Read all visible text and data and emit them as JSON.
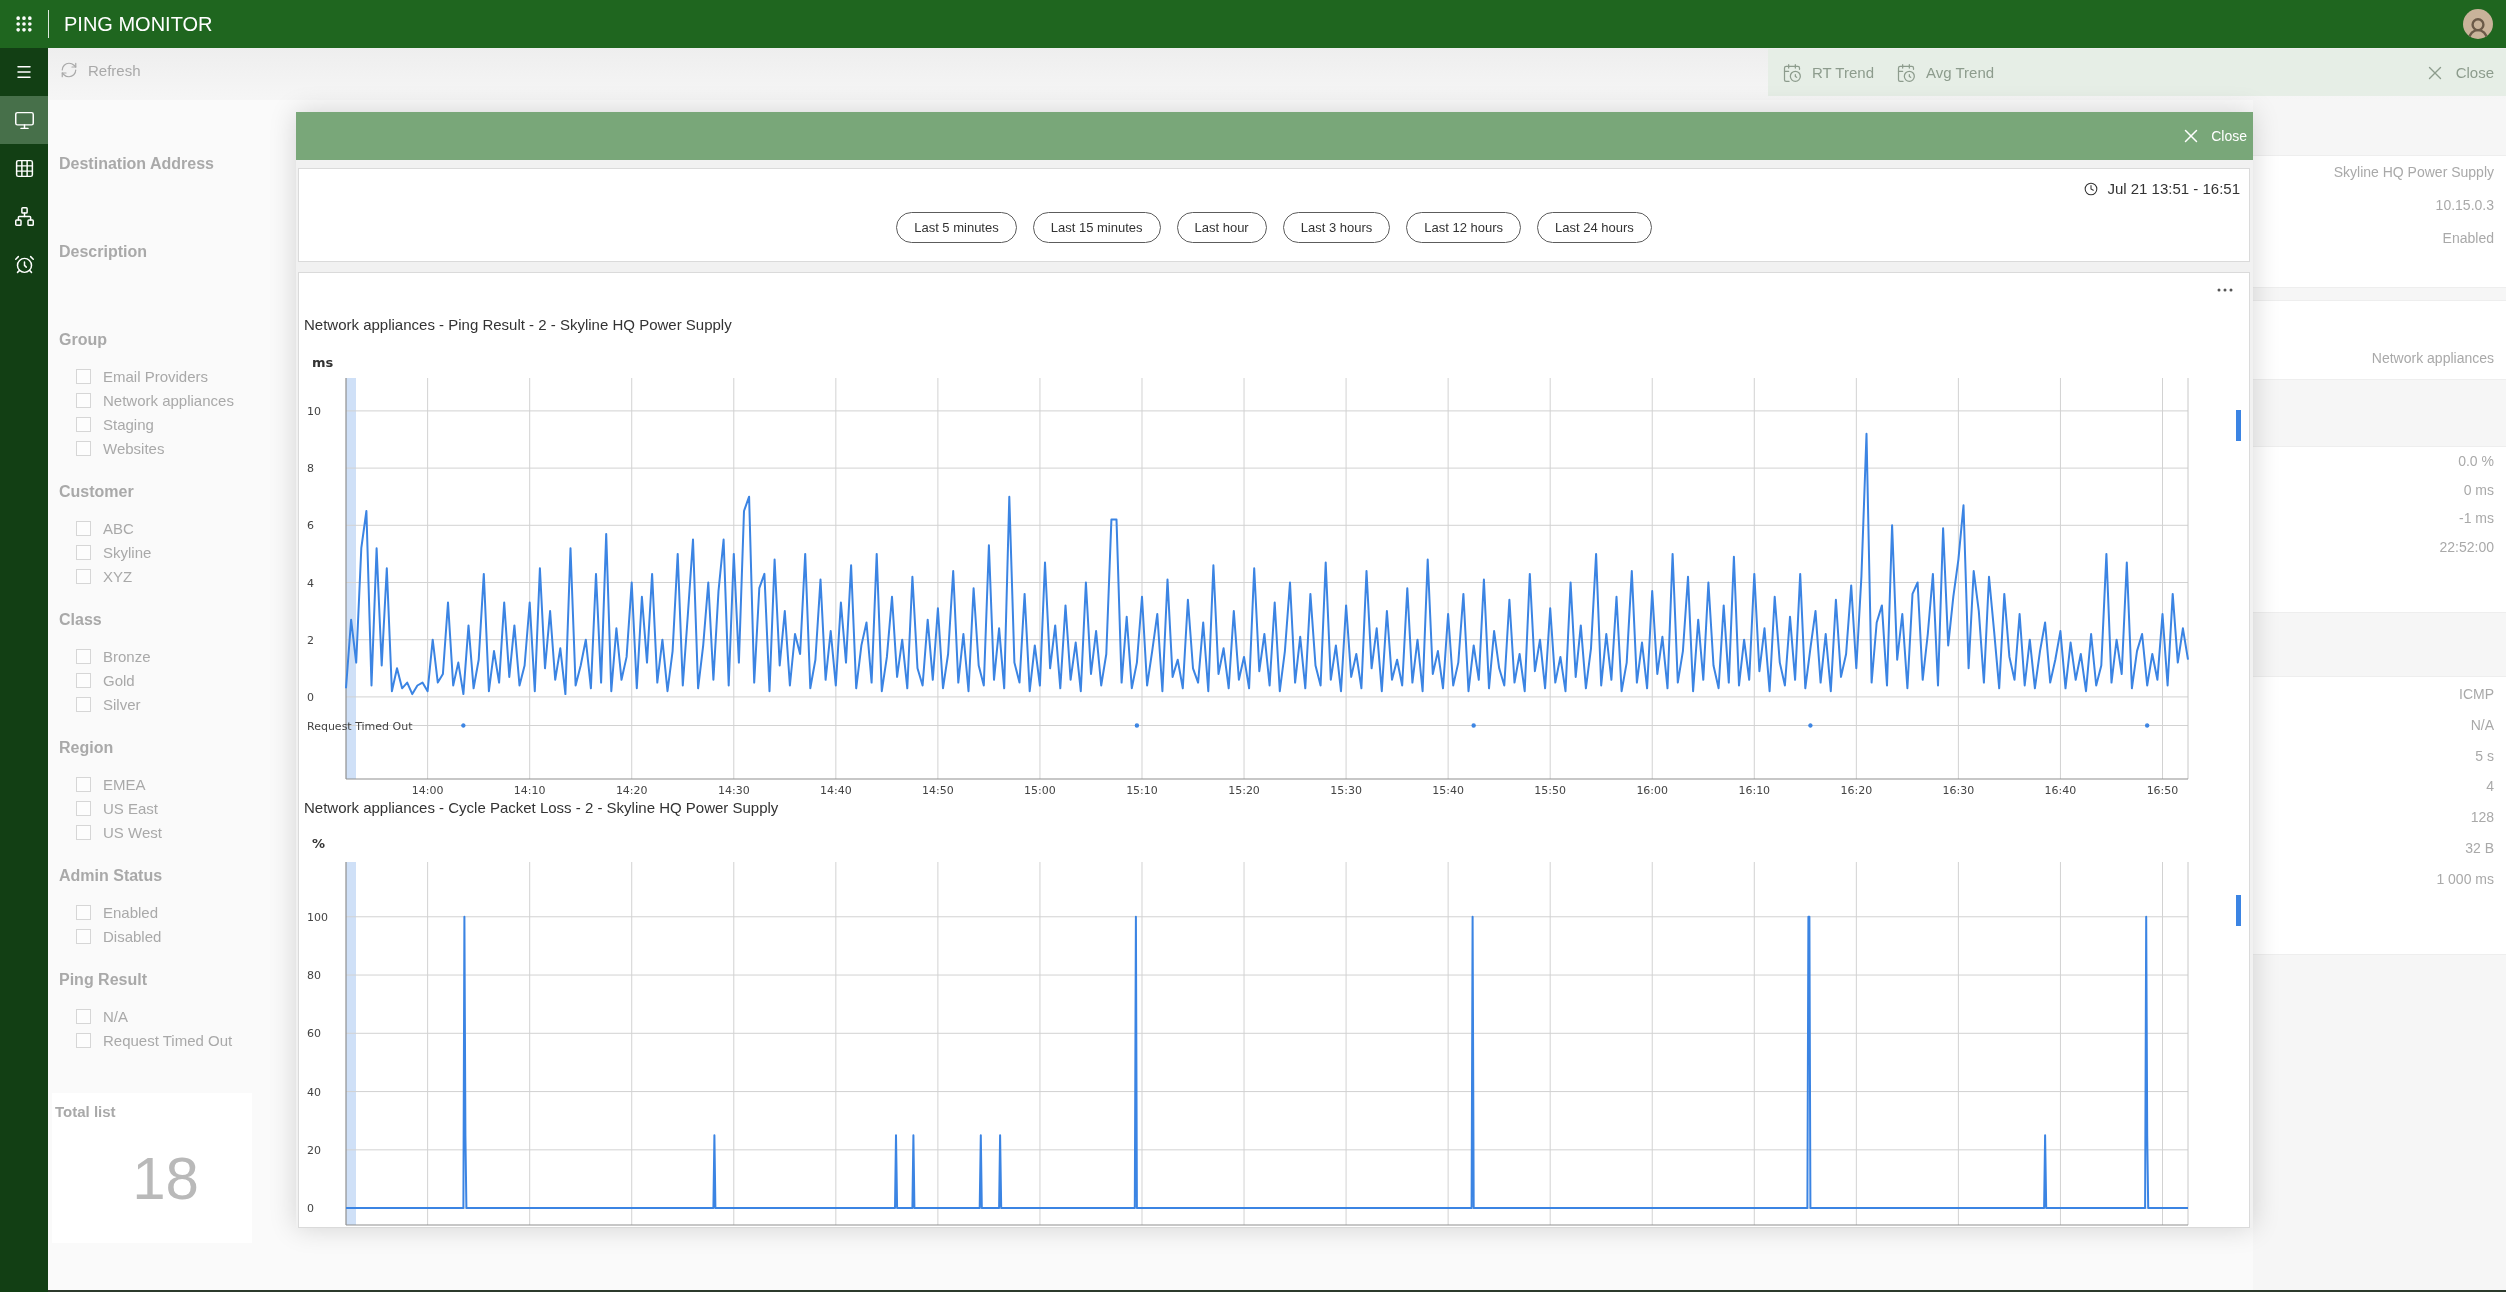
{
  "top_bar": {
    "title": "PING MONITOR"
  },
  "sidebar": {
    "items": [
      {
        "selected": true
      },
      {
        "selected": false
      },
      {
        "selected": false
      },
      {
        "selected": false
      }
    ]
  },
  "toolbar": {
    "refresh": "Refresh"
  },
  "filters": {
    "fields": [
      {
        "label": "Destination Address"
      },
      {
        "label": "Description"
      }
    ],
    "groups": [
      {
        "title": "Group",
        "options": [
          {
            "label": "Email Providers",
            "checked": false
          },
          {
            "label": "Network appliances",
            "checked": false
          },
          {
            "label": "Staging",
            "checked": false
          },
          {
            "label": "Websites",
            "checked": false
          }
        ]
      },
      {
        "title": "Customer",
        "options": [
          {
            "label": "ABC",
            "checked": false
          },
          {
            "label": "Skyline",
            "checked": false
          },
          {
            "label": "XYZ",
            "checked": false
          }
        ]
      },
      {
        "title": "Class",
        "options": [
          {
            "label": "Bronze",
            "checked": false
          },
          {
            "label": "Gold",
            "checked": false
          },
          {
            "label": "Silver",
            "checked": false
          }
        ]
      },
      {
        "title": "Region",
        "options": [
          {
            "label": "EMEA",
            "checked": false
          },
          {
            "label": "US East",
            "checked": false
          },
          {
            "label": "US West",
            "checked": false
          }
        ]
      },
      {
        "title": "Admin Status",
        "options": [
          {
            "label": "Enabled",
            "checked": false
          },
          {
            "label": "Disabled",
            "checked": false
          }
        ]
      },
      {
        "title": "Ping Result",
        "options": [
          {
            "label": "N/A",
            "checked": false
          },
          {
            "label": "Request Timed Out",
            "checked": false
          }
        ]
      }
    ]
  },
  "summary": {
    "cards": [
      {
        "title": "Total list",
        "value": "18"
      }
    ]
  },
  "detail_toolbar": {
    "buttons": [
      "RT Trend",
      "Avg Trend"
    ],
    "close": "Close"
  },
  "details": {
    "cards": [
      [
        "Skyline HQ Power Supply",
        "10.15.0.3",
        "Enabled"
      ],
      [
        "Network appliances"
      ],
      [
        "0.0 %",
        "0 ms",
        "-1 ms",
        "22:52:00"
      ],
      [
        "ICMP",
        "N/A",
        "5 s",
        "4",
        "128",
        "32 B",
        "1 000 ms"
      ]
    ]
  },
  "dialog": {
    "close": "Close",
    "time_range": "Jul 21 13:51 - 16:51",
    "presets": [
      "Last 5 minutes",
      "Last 15 minutes",
      "Last hour",
      "Last 3 hours",
      "Last 12 hours",
      "Last 24 hours"
    ],
    "charts": [
      {
        "chart_data": {
          "type": "line",
          "title": "Network appliances - Ping Result - 2 - Skyline HQ Power Supply",
          "ylabel": "ms",
          "x": [
            832,
            832.5,
            833,
            833.5,
            834,
            834.5,
            835,
            835.5,
            836,
            836.5,
            837,
            837.5,
            838,
            838.5,
            839,
            839.5,
            840,
            840.5,
            841,
            841.5,
            842,
            842.5,
            843,
            843.5,
            844,
            844.5,
            845,
            845.5,
            846,
            846.5,
            847,
            847.5,
            848,
            848.5,
            849,
            849.5,
            850,
            850.5,
            851,
            851.5,
            852,
            852.5,
            853,
            853.5,
            854,
            854.5,
            855,
            855.5,
            856,
            856.5,
            857,
            857.5,
            858,
            858.5,
            859,
            859.5,
            860,
            860.5,
            861,
            861.5,
            862,
            862.5,
            863,
            863.5,
            864,
            864.5,
            865,
            865.5,
            866,
            866.5,
            867,
            867.5,
            868,
            868.5,
            869,
            869.5,
            870,
            870.5,
            871,
            871.5,
            872,
            872.5,
            873,
            873.5,
            874,
            874.5,
            875,
            875.5,
            876,
            876.5,
            877,
            877.5,
            878,
            878.5,
            879,
            879.5,
            880,
            880.5,
            881,
            881.5,
            882,
            882.5,
            883,
            883.5,
            884,
            884.5,
            885,
            885.5,
            886,
            886.5,
            887,
            887.5,
            888,
            888.5,
            889,
            889.5,
            890,
            890.5,
            891,
            891.5,
            892,
            892.5,
            893,
            893.5,
            894,
            894.5,
            895,
            895.5,
            896,
            896.5,
            897,
            897.5,
            898,
            898.5,
            899,
            899.5,
            900,
            900.5,
            901,
            901.5,
            902,
            902.5,
            903,
            903.5,
            904,
            904.5,
            905,
            905.5,
            906,
            906.5,
            907,
            907.5,
            908,
            908.5,
            909,
            909.5,
            910,
            910.5,
            911,
            911.5,
            912,
            912.5,
            913,
            913.5,
            914,
            914.5,
            915,
            915.5,
            916,
            916.5,
            917,
            917.5,
            918,
            918.5,
            919,
            919.5,
            920,
            920.5,
            921,
            921.5,
            922,
            922.5,
            923,
            923.5,
            924,
            924.5,
            925,
            925.5,
            926,
            926.5,
            927,
            927.5,
            928,
            928.5,
            929,
            929.5,
            930,
            930.5,
            931,
            931.5,
            932,
            932.5,
            933,
            933.5,
            934,
            934.5,
            935,
            935.5,
            936,
            936.5,
            937,
            937.5,
            938,
            938.5,
            939,
            939.5,
            940,
            940.5,
            941,
            941.5,
            942,
            942.5,
            943,
            943.5,
            944,
            944.5,
            945,
            945.5,
            946,
            946.5,
            947,
            947.5,
            948,
            948.5,
            949,
            949.5,
            950,
            950.5,
            951,
            951.5,
            952,
            952.5,
            953,
            953.5,
            954,
            954.5,
            955,
            955.5,
            956,
            956.5,
            957,
            957.5,
            958,
            958.5,
            959,
            959.5,
            960,
            960.5,
            961,
            961.5,
            962,
            962.5,
            963,
            963.5,
            964,
            964.5,
            965,
            965.5,
            966,
            966.5,
            967,
            967.5,
            968,
            968.5,
            969,
            969.5,
            970,
            970.5,
            971,
            971.5,
            972,
            972.5,
            973,
            973.5,
            974,
            974.5,
            975,
            975.5,
            976,
            976.5,
            977,
            977.5,
            978,
            978.5,
            979,
            979.5,
            980,
            980.5,
            981,
            981.5,
            982,
            982.5,
            983,
            983.5,
            984,
            984.5,
            985,
            985.5,
            986,
            986.5,
            987,
            987.5,
            988,
            988.5,
            989,
            989.5,
            990,
            990.5,
            991,
            991.5,
            992,
            992.5,
            993,
            993.5,
            994,
            994.5,
            995,
            995.5,
            996,
            996.5,
            997,
            997.5,
            998,
            998.5,
            999,
            999.5,
            1000,
            1000.5,
            1001,
            1001.5,
            1002,
            1002.5,
            1003,
            1003.5,
            1004,
            1004.5,
            1005,
            1005.5,
            1006,
            1006.5,
            1007,
            1007.5,
            1008,
            1008.5,
            1009,
            1009.5,
            1010,
            1010.5,
            1011,
            1011.5,
            1012,
            1012.5
          ],
          "series": [
            {
              "color": "#3b84e3",
              "values": [
                0.3,
                2.7,
                1.2,
                5.2,
                6.5,
                0.4,
                5.2,
                1.1,
                4.5,
                0.2,
                1.0,
                0.3,
                0.5,
                0.1,
                0.4,
                0.5,
                0.2,
                2.0,
                0.5,
                0.8,
                3.3,
                0.4,
                1.2,
                0.1,
                2.5,
                0.3,
                1.3,
                4.3,
                0.2,
                1.6,
                0.5,
                3.3,
                0.7,
                2.5,
                0.4,
                1.1,
                3.3,
                0.2,
                4.5,
                1.0,
                3.0,
                0.6,
                1.7,
                0.1,
                5.2,
                0.4,
                1.1,
                2.0,
                0.3,
                4.3,
                0.5,
                5.7,
                0.2,
                2.4,
                0.6,
                1.4,
                4.0,
                0.3,
                3.5,
                1.2,
                4.3,
                0.5,
                2.0,
                0.2,
                1.6,
                5.0,
                0.4,
                2.9,
                5.5,
                0.3,
                1.8,
                4.0,
                0.6,
                3.7,
                5.5,
                0.4,
                5.0,
                1.2,
                6.5,
                7.0,
                0.5,
                3.8,
                4.3,
                0.2,
                4.8,
                1.1,
                3.0,
                0.4,
                2.2,
                1.5,
                5.0,
                0.3,
                1.3,
                4.1,
                0.6,
                2.3,
                0.4,
                3.3,
                1.2,
                4.6,
                0.3,
                1.8,
                2.6,
                0.5,
                5.0,
                0.2,
                1.4,
                3.5,
                0.7,
                2.0,
                0.3,
                4.2,
                1.0,
                0.4,
                2.7,
                0.6,
                3.1,
                0.3,
                1.5,
                4.4,
                0.5,
                2.2,
                0.2,
                3.8,
                1.1,
                0.4,
                5.3,
                0.6,
                2.4,
                0.3,
                7.0,
                1.2,
                0.5,
                3.6,
                0.2,
                1.8,
                0.4,
                4.7,
                1.0,
                2.5,
                0.3,
                3.2,
                0.6,
                1.9,
                0.2,
                4.0,
                0.8,
                2.3,
                0.4,
                1.5,
                6.2,
                6.2,
                0.5,
                2.8,
                0.3,
                1.2,
                3.5,
                0.4,
                1.6,
                2.9,
                0.2,
                4.1,
                0.7,
                1.3,
                0.3,
                3.4,
                1.0,
                0.5,
                2.6,
                0.2,
                4.6,
                0.8,
                1.7,
                0.3,
                3.0,
                0.6,
                1.4,
                0.3,
                4.5,
                0.9,
                2.2,
                0.4,
                3.3,
                0.2,
                1.6,
                4.0,
                0.5,
                2.1,
                0.3,
                3.6,
                1.1,
                0.4,
                4.7,
                0.6,
                1.8,
                0.2,
                3.2,
                0.7,
                1.5,
                0.3,
                4.4,
                1.0,
                2.4,
                0.2,
                3.0,
                0.6,
                1.3,
                0.4,
                3.8,
                0.5,
                2.0,
                0.2,
                4.8,
                0.8,
                1.6,
                0.3,
                2.9,
                0.4,
                1.2,
                3.6,
                0.2,
                1.8,
                0.6,
                4.1,
                0.3,
                2.3,
                1.0,
                0.4,
                3.4,
                0.5,
                1.5,
                0.2,
                4.3,
                0.9,
                2.0,
                0.3,
                3.1,
                0.5,
                1.4,
                0.2,
                4.0,
                0.7,
                2.5,
                0.3,
                1.7,
                5.0,
                0.4,
                2.2,
                0.6,
                3.5,
                0.2,
                1.2,
                4.4,
                0.5,
                1.9,
                0.3,
                3.7,
                0.8,
                2.1,
                0.3,
                5.0,
                0.5,
                1.6,
                4.2,
                0.2,
                2.7,
                0.6,
                4.0,
                1.1,
                0.3,
                3.2,
                0.5,
                4.9,
                0.4,
                2.0,
                0.6,
                4.3,
                0.9,
                2.4,
                0.2,
                3.5,
                1.2,
                0.4,
                2.8,
                0.6,
                4.3,
                0.3,
                1.7,
                3.0,
                0.5,
                2.2,
                0.2,
                3.4,
                0.7,
                1.5,
                3.9,
                1.0,
                4.2,
                9.2,
                0.5,
                2.6,
                3.2,
                0.4,
                6.0,
                1.3,
                2.9,
                0.3,
                3.6,
                4.0,
                0.6,
                2.2,
                4.3,
                0.4,
                5.9,
                1.8,
                3.5,
                4.8,
                6.7,
                1.0,
                4.4,
                3.0,
                0.5,
                4.2,
                2.3,
                0.3,
                3.6,
                1.4,
                0.6,
                2.9,
                0.4,
                2.0,
                0.3,
                1.6,
                2.6,
                0.5,
                1.3,
                2.3,
                0.3,
                1.9,
                0.6,
                1.5,
                0.2,
                2.2,
                0.4,
                1.1,
                5.0,
                0.5,
                2.0,
                0.8,
                4.7,
                0.3,
                1.6,
                2.2,
                0.4,
                1.5,
                0.6,
                2.9,
                0.4,
                3.6,
                1.2,
                2.4,
                1.3
              ]
            },
            {
              "color": "#3b84e3",
              "values": [
                null,
                null,
                null,
                null,
                null,
                null,
                null,
                null,
                null,
                null,
                null,
                null,
                null,
                null,
                null,
                null,
                null,
                null,
                null,
                null,
                null,
                null,
                null,
                -1,
                null,
                null,
                null,
                null,
                null,
                null,
                null,
                null,
                null,
                null,
                null,
                null,
                null,
                null,
                null,
                null,
                null,
                null,
                null,
                null,
                null,
                null,
                null,
                null,
                null,
                null,
                null,
                null,
                null,
                null,
                null,
                null,
                null,
                null,
                null,
                null,
                null,
                null,
                null,
                null,
                null,
                null,
                null,
                null,
                null,
                null,
                null,
                null,
                null,
                null,
                null,
                null,
                null,
                null,
                null,
                null,
                null,
                null,
                null,
                null,
                null,
                null,
                null,
                null,
                null,
                null,
                null,
                null,
                null,
                null,
                null,
                null,
                null,
                null,
                null,
                null,
                null,
                null,
                null,
                null,
                null,
                null,
                null,
                null,
                null,
                null,
                null,
                null,
                null,
                null,
                null,
                null,
                null,
                null,
                null,
                null,
                null,
                null,
                null,
                null,
                null,
                null,
                null,
                null,
                null,
                null,
                null,
                null,
                null,
                null,
                null,
                null,
                null,
                null,
                null,
                null,
                null,
                null,
                null,
                null,
                null,
                null,
                null,
                null,
                null,
                null,
                null,
                null,
                null,
                null,
                null,
                -1,
                null,
                null,
                null,
                null,
                null,
                null,
                null,
                null,
                null,
                null,
                null,
                null,
                null,
                null,
                null,
                null,
                null,
                null,
                null,
                null,
                null,
                null,
                null,
                null,
                null,
                null,
                null,
                null,
                null,
                null,
                null,
                null,
                null,
                null,
                null,
                null,
                null,
                null,
                null,
                null,
                null,
                null,
                null,
                null,
                null,
                null,
                null,
                null,
                null,
                null,
                null,
                null,
                null,
                null,
                null,
                null,
                null,
                null,
                null,
                null,
                null,
                null,
                null,
                null,
                null,
                -1,
                null,
                null,
                null,
                null,
                null,
                null,
                null,
                null,
                null,
                null,
                null,
                null,
                null,
                null,
                null,
                null,
                null,
                null,
                null,
                null,
                null,
                null,
                null,
                null,
                null,
                null,
                null,
                null,
                null,
                null,
                null,
                null,
                null,
                null,
                null,
                null,
                null,
                null,
                null,
                null,
                null,
                null,
                null,
                null,
                null,
                null,
                null,
                null,
                null,
                null,
                null,
                null,
                null,
                null,
                null,
                null,
                null,
                null,
                null,
                null,
                null,
                null,
                null,
                null,
                null,
                -1,
                null,
                null,
                null,
                null,
                null,
                null,
                null,
                null,
                null,
                null,
                null,
                null,
                null,
                null,
                null,
                null,
                null,
                null,
                null,
                null,
                null,
                null,
                null,
                null,
                null,
                null,
                null,
                null,
                null,
                null,
                null,
                null,
                null,
                null,
                null,
                null,
                null,
                null,
                null,
                null,
                null,
                null,
                null,
                null,
                null,
                null,
                null,
                null,
                null,
                null,
                null,
                null,
                null,
                null,
                null,
                null,
                null,
                null,
                null,
                null,
                null,
                null,
                null,
                null,
                null,
                -1,
                null,
                null,
                null,
                null,
                null,
                null,
                null,
                null
              ]
            }
          ],
          "xlim": [
            832,
            1012.5
          ],
          "ylim": [
            -2.87,
            11.15
          ],
          "grid": true,
          "xticks": [
            {
              "value": 840,
              "label": "14:00"
            },
            {
              "value": 850,
              "label": "14:10"
            },
            {
              "value": 860,
              "label": "14:20"
            },
            {
              "value": 870,
              "label": "14:30"
            },
            {
              "value": 880,
              "label": "14:40"
            },
            {
              "value": 890,
              "label": "14:50"
            },
            {
              "value": 900,
              "label": "15:00"
            },
            {
              "value": 910,
              "label": "15:10"
            },
            {
              "value": 920,
              "label": "15:20"
            },
            {
              "value": 930,
              "label": "15:30"
            },
            {
              "value": 940,
              "label": "15:40"
            },
            {
              "value": 950,
              "label": "15:50"
            },
            {
              "value": 960,
              "label": "16:00"
            },
            {
              "value": 970,
              "label": "16:10"
            },
            {
              "value": 980,
              "label": "16:20"
            },
            {
              "value": 990,
              "label": "16:30"
            },
            {
              "value": 1000,
              "label": "16:40"
            },
            {
              "value": 1010,
              "label": "16:50"
            }
          ],
          "yticks": [
            {
              "value": -1,
              "label": "Request Timed Out"
            },
            0,
            2,
            4,
            6,
            8,
            10
          ]
        }
      },
      {
        "chart_data": {
          "type": "line",
          "title": "Network appliances - Cycle Packet Loss - 2 - Skyline HQ Power Supply",
          "ylabel": "%",
          "x": [
            832,
            843.5,
            843.6,
            843.7,
            843.8,
            868,
            868.1,
            868.2,
            885.8,
            885.9,
            886,
            887.5,
            887.6,
            887.7,
            894.1,
            894.2,
            894.3,
            896,
            896.1,
            896.2,
            909.3,
            909.4,
            909.5,
            942.3,
            942.4,
            942.5,
            975.2,
            975.3,
            975.4,
            975.5,
            998.4,
            998.5,
            998.6,
            1008.3,
            1008.4,
            1008.5,
            1008.6,
            1012.5
          ],
          "series": [
            {
              "color": "#3b84e3",
              "values": [
                0,
                0,
                100,
                25,
                0,
                0,
                25,
                0,
                0,
                25,
                0,
                0,
                25,
                0,
                0,
                25,
                0,
                0,
                25,
                0,
                0,
                100,
                0,
                0,
                100,
                0,
                0,
                100,
                100,
                0,
                0,
                25,
                0,
                0,
                100,
                25,
                0,
                0
              ]
            }
          ],
          "xlim": [
            832,
            1012.5
          ],
          "ylim": [
            -5.8,
            118.8
          ],
          "grid": true,
          "yticks": [
            0,
            20,
            40,
            60,
            80,
            100
          ]
        }
      }
    ]
  }
}
